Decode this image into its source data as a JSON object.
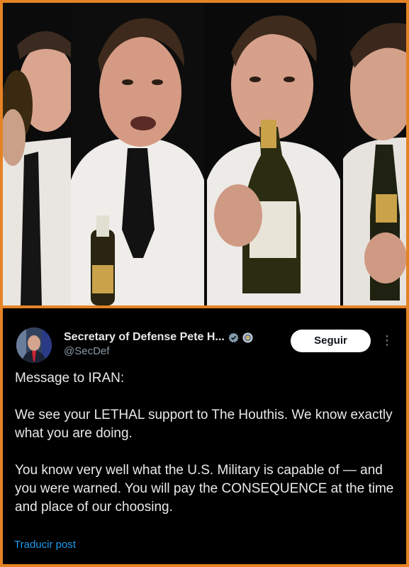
{
  "tweet": {
    "display_name": "Secretary of Defense Pete H...",
    "handle": "@SecDef",
    "follow_label": "Seguir",
    "paragraphs": [
      "Message to IRAN:",
      "We see your LETHAL support to The Houthis. We know exactly what you are doing.",
      "You know very well what the U.S. Military is capable of — and you were warned. You will pay the CONSEQUENCE at the time and place of our choosing."
    ],
    "translate_label": "Traducir post"
  },
  "icons": {
    "verified": "verified-badge-icon",
    "government": "government-seal-icon",
    "more": "more-options-icon"
  },
  "colors": {
    "frame": "#e58324",
    "background": "#000000",
    "text": "#e7e9ea",
    "secondary_text": "#8b98a5",
    "link": "#1d9bf0",
    "follow_button_bg": "#ffffff",
    "verified_badge": "#829aab"
  }
}
